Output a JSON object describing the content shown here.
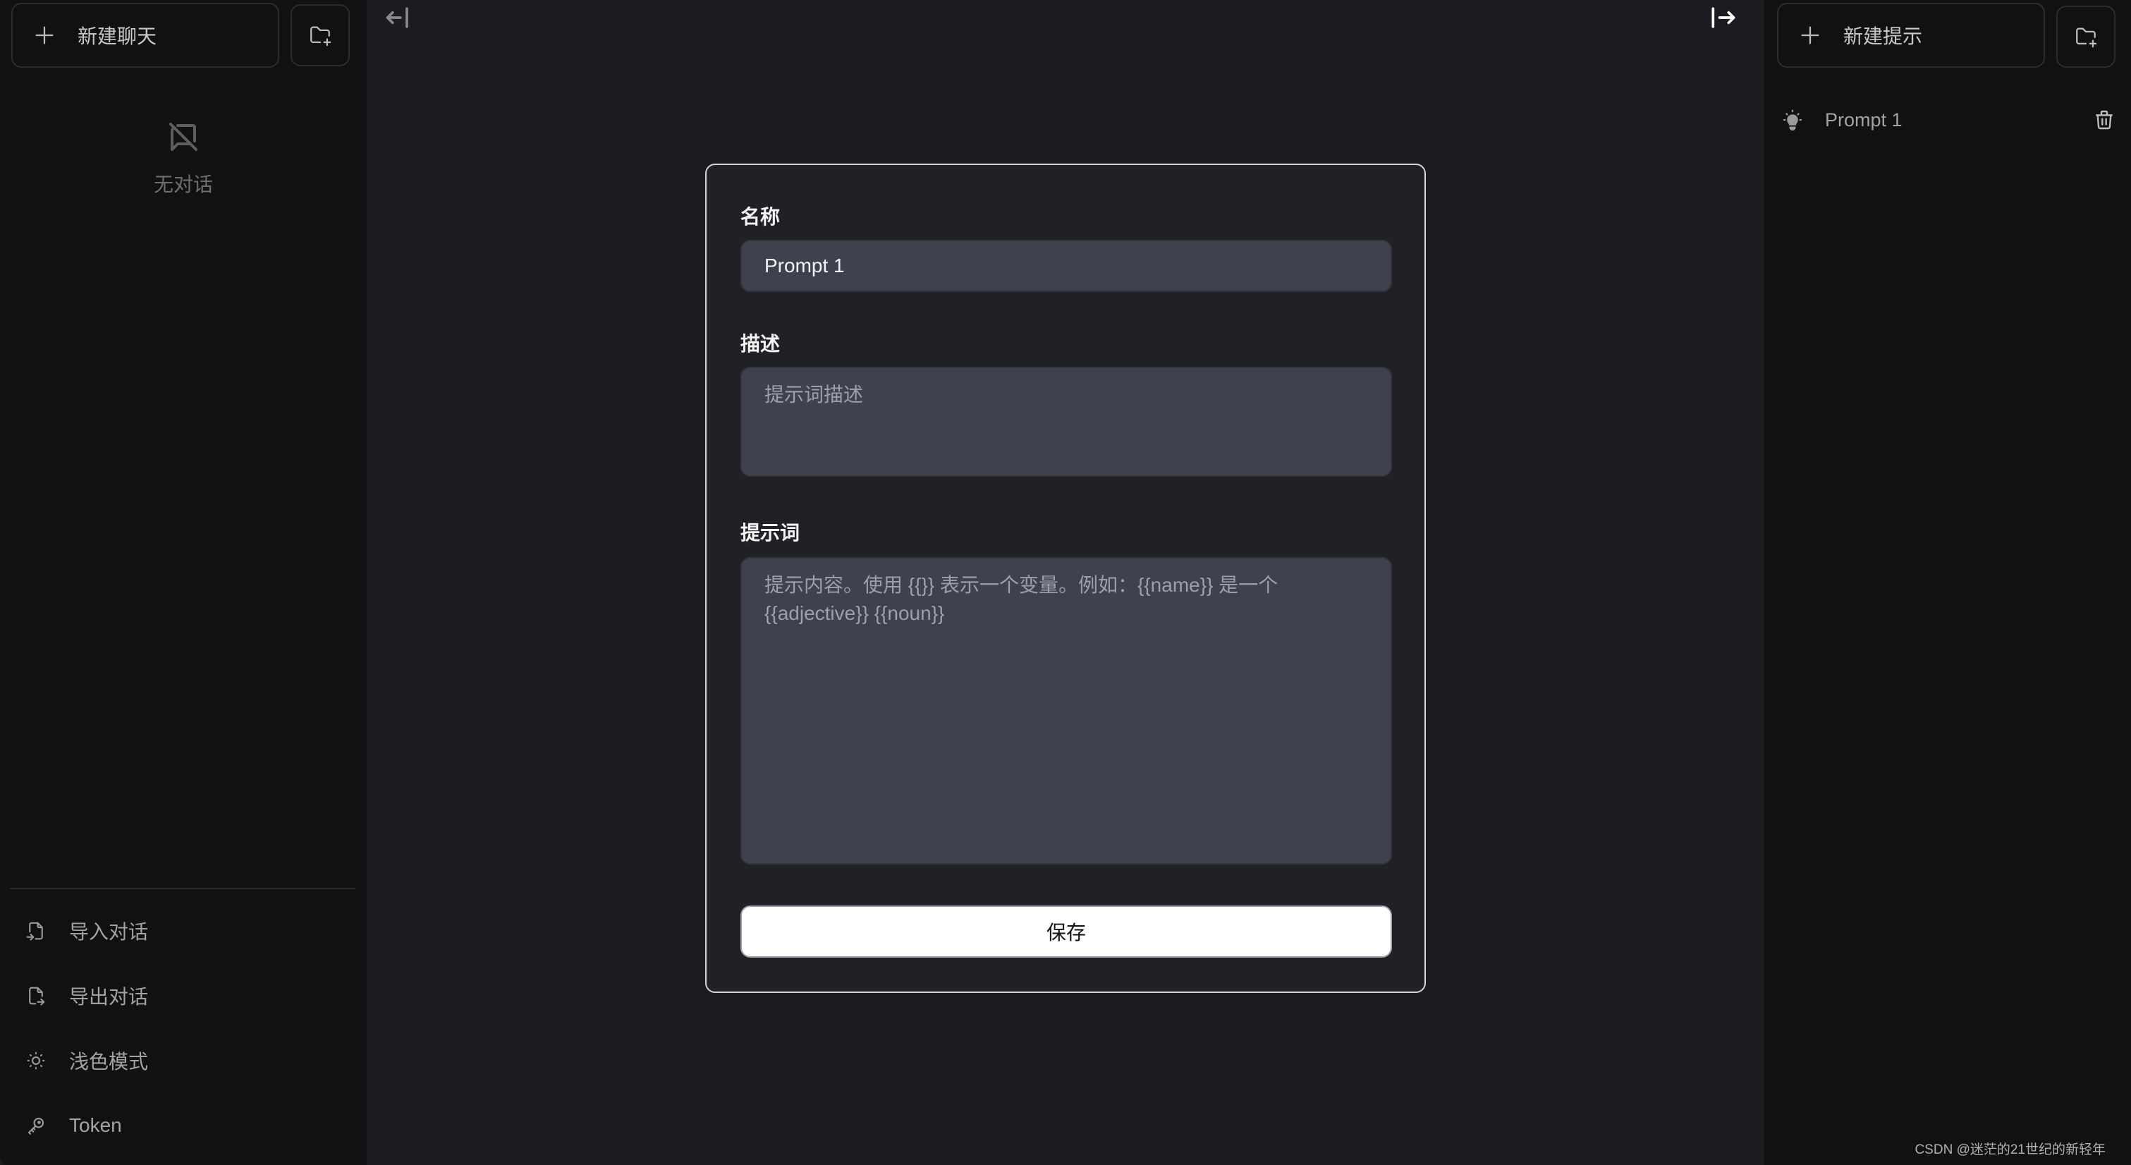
{
  "left_sidebar": {
    "new_chat_label": "新建聊天",
    "new_chat_icon": "plus-icon",
    "new_folder_icon": "folder-plus-icon",
    "empty_state": {
      "icon": "message-off-icon",
      "label": "无对话"
    },
    "menu": [
      {
        "label": "导入对话",
        "icon": "file-import-icon"
      },
      {
        "label": "导出对话",
        "icon": "file-export-icon"
      },
      {
        "label": "浅色模式",
        "icon": "sun-icon"
      },
      {
        "label": "Token",
        "icon": "key-icon"
      }
    ]
  },
  "main": {
    "collapse_left_icon": "arrow-bar-left-icon",
    "collapse_right_icon": "arrow-bar-right-icon"
  },
  "modal": {
    "name_label": "名称",
    "name_value": "Prompt 1",
    "description_label": "描述",
    "description_value": "",
    "description_placeholder": "提示词描述",
    "prompt_label": "提示词",
    "prompt_value": "",
    "prompt_placeholder": "提示内容。使用 {{}} 表示一个变量。例如：{{name}} 是一个 {{adjective}} {{noun}}",
    "save_label": "保存"
  },
  "right_sidebar": {
    "new_prompt_label": "新建提示",
    "new_prompt_icon": "plus-icon",
    "new_folder_icon": "folder-plus-icon",
    "prompts": [
      {
        "name": "Prompt 1",
        "icon": "bulb-icon",
        "action_icon": "trash-icon"
      }
    ]
  },
  "watermark": "CSDN @迷茫的21世纪的新轻年"
}
